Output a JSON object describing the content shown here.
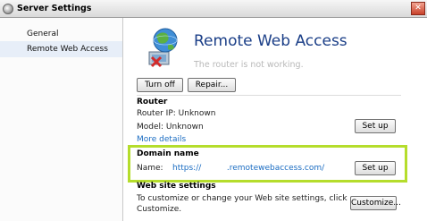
{
  "window": {
    "title": "Server Settings",
    "close_label": "✕"
  },
  "sidebar": {
    "items": [
      {
        "label": "General"
      },
      {
        "label": "Remote Web Access"
      }
    ]
  },
  "main": {
    "title": "Remote Web Access",
    "status": "The router is not working.",
    "buttons": {
      "turn_off": "Turn off",
      "repair": "Repair..."
    },
    "router": {
      "section_title": "Router",
      "ip": "Router IP: Unknown",
      "model": "Model: Unknown",
      "setup_label": "Set up",
      "more_details": "More details"
    },
    "domain": {
      "section_title": "Domain name",
      "name_label": "Name:",
      "url": "https://          .remotewebaccess.com/",
      "setup_label": "Set up"
    },
    "website": {
      "section_title": "Web site settings",
      "description_line1": "To customize or change your Web site settings, click",
      "description_line2": "Customize.",
      "customize_label": "Customize..."
    }
  },
  "colors": {
    "title_blue": "#1a3e87",
    "link_blue": "#1a6cc2",
    "highlight_green": "#b5dd2c"
  }
}
